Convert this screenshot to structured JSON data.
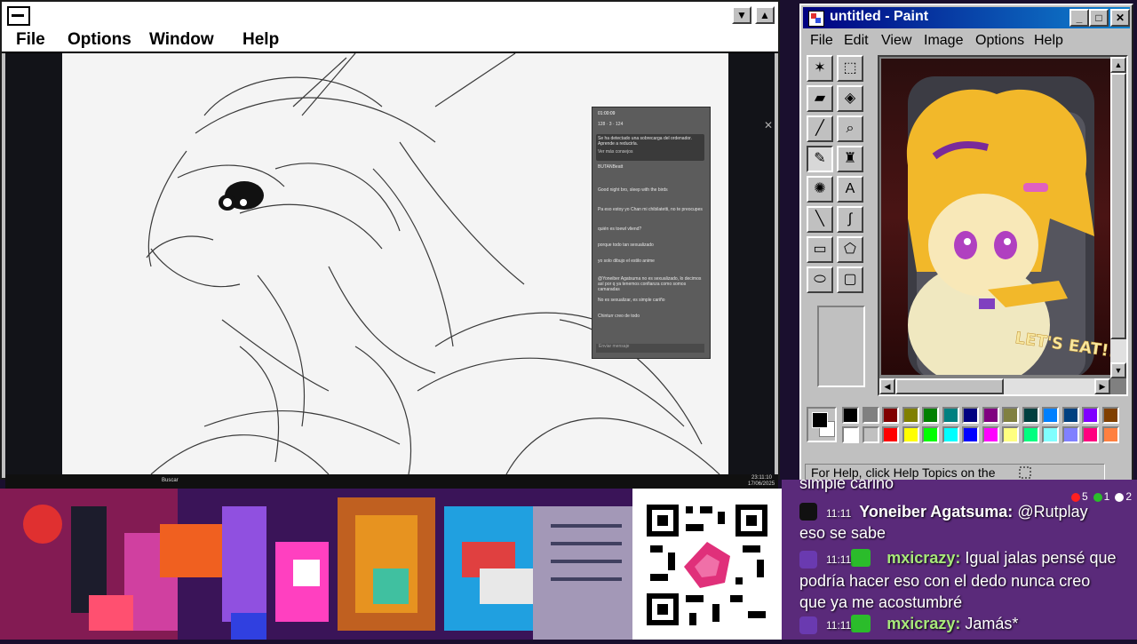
{
  "left_window": {
    "menu": [
      "File",
      "Options",
      "Window",
      "Help"
    ],
    "controls": {
      "minimize": "▼",
      "maximize": "▲"
    },
    "stream_overlay": {
      "timer": "01:00:09",
      "stats": [
        "128",
        "3",
        "124"
      ],
      "notice": "Se ha detectado una sobrecarga del ordenador. Aprende a reducirla.",
      "notice_link": "Ver más consejos",
      "supporter": "BUTANBeatt",
      "lines": [
        "Good night bro, sleep with the birds",
        "Pa eso estoy yo Chan mi chibilatetti, no te preocupes",
        "quién es toewl vliend?",
        "porque todo tan sexualizado",
        "yo solo dibujo el estilo anime",
        "@Yoneiber Agatsuma no es sexualizado, lo decimos así por q ya tenemos confianza como somos camaradas",
        "No es sexualizar, es simple cariño",
        "Chinturr creo de todo"
      ],
      "input_placeholder": "Enviar mensaje"
    },
    "taskbar": {
      "search": "Buscar",
      "clock": "23:11:10",
      "date": "17/06/2025"
    }
  },
  "paint": {
    "title": "untitled - Paint",
    "menu": [
      "File",
      "Edit",
      "View",
      "Image",
      "Options",
      "Help"
    ],
    "tools": [
      {
        "icon": "free-select-icon",
        "glyph": "✶"
      },
      {
        "icon": "rect-select-icon",
        "glyph": "⬚"
      },
      {
        "icon": "eraser-icon",
        "glyph": "▰"
      },
      {
        "icon": "fill-icon",
        "glyph": "◈"
      },
      {
        "icon": "picker-icon",
        "glyph": "╱"
      },
      {
        "icon": "magnifier-icon",
        "glyph": "⌕"
      },
      {
        "icon": "pencil-icon",
        "glyph": "✎"
      },
      {
        "icon": "brush-icon",
        "glyph": "♜"
      },
      {
        "icon": "airbrush-icon",
        "glyph": "✺"
      },
      {
        "icon": "text-icon",
        "glyph": "A"
      },
      {
        "icon": "line-icon",
        "glyph": "╲"
      },
      {
        "icon": "curve-icon",
        "glyph": "∫"
      },
      {
        "icon": "rectangle-icon",
        "glyph": "▭"
      },
      {
        "icon": "polygon-icon",
        "glyph": "⬠"
      },
      {
        "icon": "ellipse-icon",
        "glyph": "⬭"
      },
      {
        "icon": "rounded-rect-icon",
        "glyph": "▢"
      }
    ],
    "palette": [
      "#000000",
      "#808080",
      "#800000",
      "#808000",
      "#008000",
      "#008080",
      "#000080",
      "#800080",
      "#808040",
      "#004040",
      "#0080ff",
      "#004080",
      "#8000ff",
      "#804000",
      "#ffffff",
      "#c0c0c0",
      "#ff0000",
      "#ffff00",
      "#00ff00",
      "#00ffff",
      "#0000ff",
      "#ff00ff",
      "#ffff80",
      "#00ff80",
      "#80ffff",
      "#8080ff",
      "#ff0080",
      "#ff8040"
    ],
    "canvas_text": "LET'S EAT!!!",
    "status": "For Help, click Help Topics on the"
  },
  "chat": {
    "counters": [
      {
        "color": "#ff2020",
        "count": "5"
      },
      {
        "color": "#2bbc2b",
        "count": "1"
      },
      {
        "color": "#ffffff",
        "count": "2"
      }
    ],
    "partial_top": "simple cariño",
    "messages": [
      {
        "platform": "tiktok",
        "time": "11:11",
        "user": "Yoneiber Agatsuma:",
        "text": "@Rutplay",
        "cont": "eso se sabe"
      },
      {
        "platform": "twitch",
        "time": "11:11",
        "user": "mxicrazy:",
        "text": "Igual jalas pensé que",
        "cont": "podría hacer eso con el dedo nunca creo",
        "cont2": "que ya me acostumbré"
      },
      {
        "platform": "twitch",
        "time": "11:11",
        "user": "mxicrazy:",
        "text": "Jamás*"
      }
    ]
  }
}
